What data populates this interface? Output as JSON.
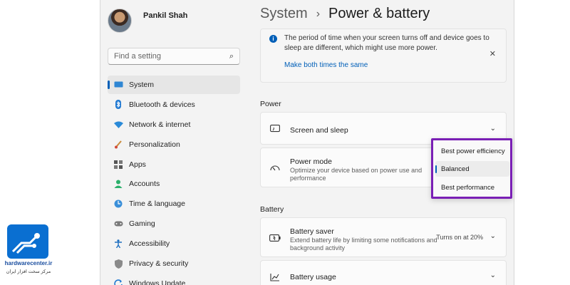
{
  "sidebar": {
    "profile_name": "Pankil Shah",
    "search_placeholder": "Find a setting",
    "items": [
      {
        "label": "System",
        "icon": "monitor-icon",
        "active": true
      },
      {
        "label": "Bluetooth & devices",
        "icon": "bluetooth-icon"
      },
      {
        "label": "Network & internet",
        "icon": "wifi-icon"
      },
      {
        "label": "Personalization",
        "icon": "brush-icon"
      },
      {
        "label": "Apps",
        "icon": "apps-icon"
      },
      {
        "label": "Accounts",
        "icon": "person-icon"
      },
      {
        "label": "Time & language",
        "icon": "globe-clock-icon"
      },
      {
        "label": "Gaming",
        "icon": "gamepad-icon"
      },
      {
        "label": "Accessibility",
        "icon": "accessibility-icon"
      },
      {
        "label": "Privacy & security",
        "icon": "shield-icon"
      },
      {
        "label": "Windows Update",
        "icon": "update-icon"
      }
    ]
  },
  "breadcrumb": {
    "parent": "System",
    "separator": "›",
    "current": "Power & battery"
  },
  "info": {
    "text": "The period of time when your screen turns off and device goes to sleep are different, which might use more power.",
    "link": "Make both times the same"
  },
  "power_section": {
    "title": "Power",
    "screen_sleep": {
      "title": "Screen and sleep"
    },
    "power_mode": {
      "title": "Power mode",
      "description": "Optimize your device based on power use and performance"
    }
  },
  "power_mode_options": {
    "options": [
      "Best power efficiency",
      "Balanced",
      "Best performance"
    ],
    "selected": "Balanced"
  },
  "battery_section": {
    "title": "Battery",
    "battery_saver": {
      "title": "Battery saver",
      "description": "Extend battery life by limiting some notifications and background activity",
      "status": "Turns on at 20%"
    },
    "battery_usage": {
      "title": "Battery usage"
    }
  },
  "logo": {
    "brand": "hardwarecenter.ir",
    "tagline": "مرکز سخت افزار ایران"
  },
  "colors": {
    "accent": "#005fb8",
    "highlight_border": "#7a1fb5"
  }
}
